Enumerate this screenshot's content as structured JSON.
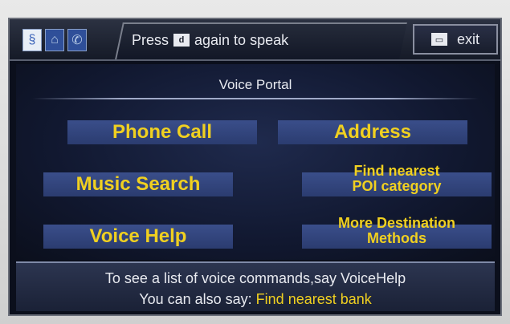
{
  "header": {
    "icons": [
      "voice-icon",
      "map-icon",
      "phone-icon"
    ],
    "prompt_before": "Press",
    "prompt_after": "again to speak",
    "talk_icon_name": "talk-button-icon",
    "exit_label": "exit",
    "exit_icon_name": "exit-icon"
  },
  "portal": {
    "title": "Voice Portal",
    "options": {
      "phone_call": "Phone Call",
      "address": "Address",
      "music_search": "Music Search",
      "find_poi_1": "Find nearest",
      "find_poi_2": "POI category",
      "voice_help": "Voice Help",
      "more_dest_1": "More Destination",
      "more_dest_2": "Methods"
    }
  },
  "info": {
    "line1": "To see a list of voice commands,say VoiceHelp",
    "line2_prefix": "You can also say:",
    "line2_highlight": "Find nearest bank"
  },
  "colors": {
    "option_text": "#f0d020",
    "option_bg": "#2b3c70",
    "screen_bg": "#0b0f1c"
  }
}
